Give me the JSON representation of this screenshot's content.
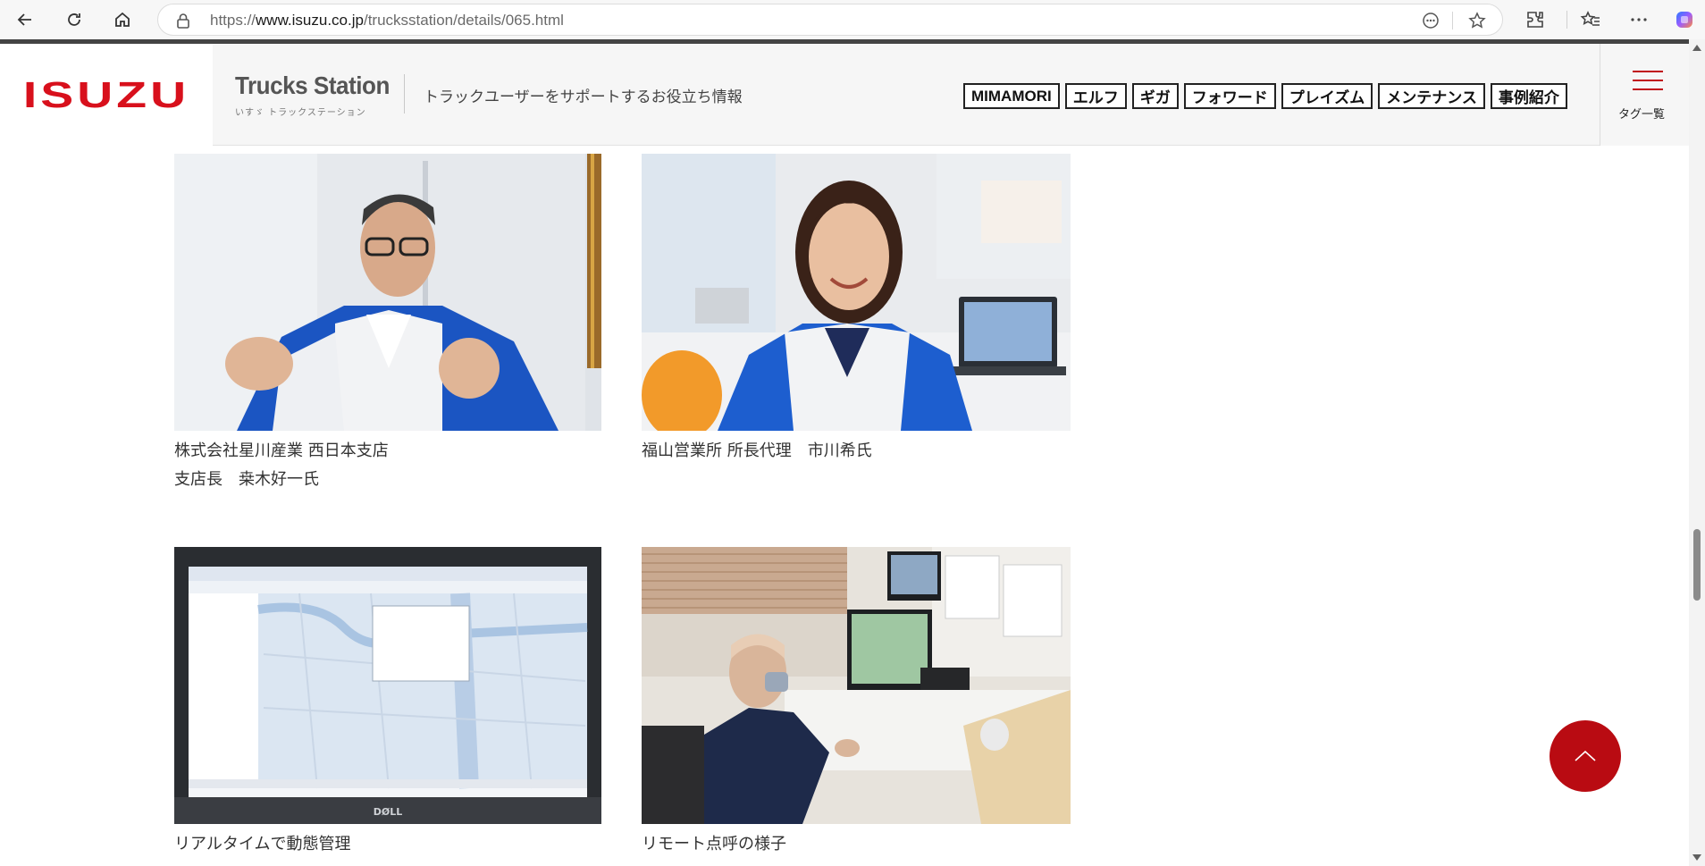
{
  "browser": {
    "url_prefix": "https://",
    "url_host": "www.isuzu.co.jp",
    "url_path": "/trucksstation/details/065.html"
  },
  "header": {
    "logo": "ISUZU",
    "site_title": "Trucks Station",
    "site_subtitle": "いすゞ トラックステーション",
    "tagline": "トラックユーザーをサポートするお役立ち情報",
    "tags": [
      "MIMAMORI",
      "エルフ",
      "ギガ",
      "フォワード",
      "プレイズム",
      "メンテナンス",
      "事例紹介"
    ],
    "menu_label": "タグ一覧",
    "accent_color": "#c00c18"
  },
  "photos": [
    {
      "caption_lines": [
        "株式会社星川産業 西日本支店",
        "支店長　桒木好一氏"
      ]
    },
    {
      "caption_lines": [
        "福山営業所 所長代理　市川希氏"
      ]
    },
    {
      "caption_lines": [
        "リアルタイムで動態管理"
      ]
    },
    {
      "caption_lines": [
        "リモート点呼の様子"
      ]
    }
  ],
  "laptop_brand": "DØLL"
}
